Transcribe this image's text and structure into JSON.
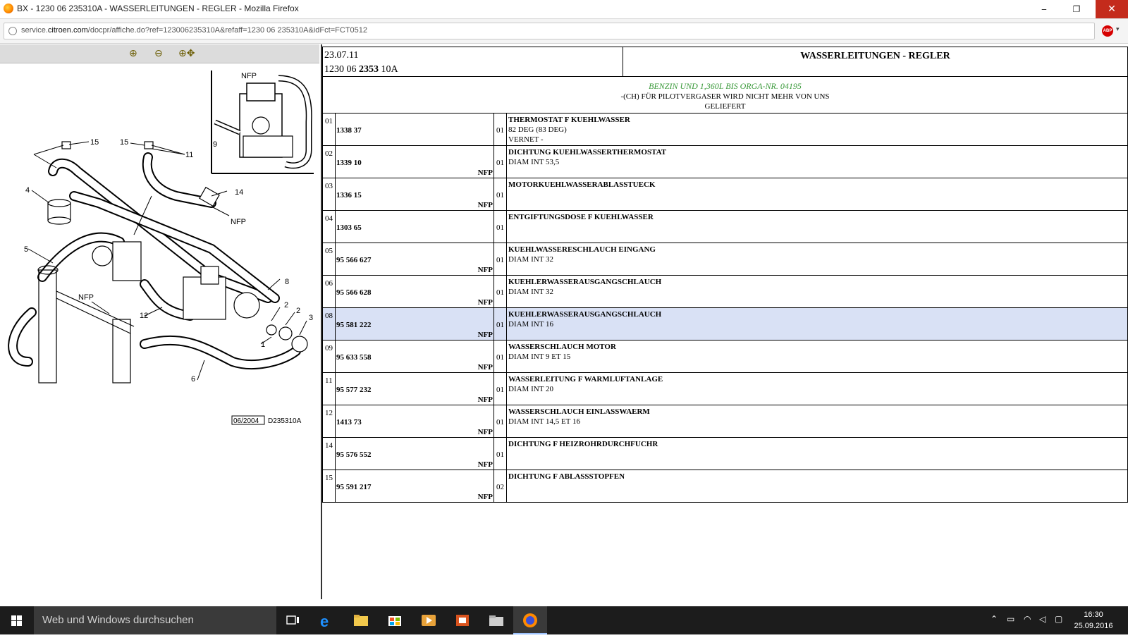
{
  "window": {
    "title": "BX - 1230 06 235310A - WASSERLEITUNGEN - REGLER - Mozilla Firefox",
    "minimize": "‒",
    "maximize": "❐",
    "close": "✕"
  },
  "address": {
    "url_pre": "service.",
    "url_domain": "citroen.com",
    "url_post": "/docpr/affiche.do?ref=123006235310A&refaff=1230 06 235310A&idFct=FCT0512",
    "abp": "ABP"
  },
  "toolbar": {
    "zoom_in": "⊕",
    "zoom_out": "⊖",
    "zoom_pan": "⊕✥"
  },
  "diagram": {
    "labels": [
      "NFP",
      "9",
      "15",
      "15",
      "11",
      "4",
      "14",
      "NFP",
      "5",
      "8",
      "NFP",
      "2",
      "2",
      "3",
      "12",
      "1",
      "6"
    ],
    "stamp_date": "06/2004",
    "stamp_code": "D235310A"
  },
  "header": {
    "date": "23.07.11",
    "part_pre": "1230 06 ",
    "part_bold": "2353",
    "part_post": " 10A",
    "title": "WASSERLEITUNGEN - REGLER"
  },
  "notes": {
    "green": "BENZIN UND 1,360L BIS ORGA-NR. 04195",
    "line1": "-(CH) FÜR PILOTVERGASER WIRD NICHT MEHR VON UNS",
    "line2": "GELIEFERT"
  },
  "rows": [
    {
      "idx": "01",
      "ref": "1338 37",
      "nfp": "",
      "qty": "01",
      "d1": "THERMOSTAT F KUEHLWASSER",
      "d2": "82 DEG (83 DEG)",
      "d3": "VERNET -"
    },
    {
      "idx": "02",
      "ref": "1339 10",
      "nfp": "NFP",
      "qty": "01",
      "d1": "DICHTUNG KUEHLWASSERTHERMOSTAT",
      "d2": "DIAM INT 53,5",
      "d3": ""
    },
    {
      "idx": "03",
      "ref": "1336 15",
      "nfp": "NFP",
      "qty": "01",
      "d1": "MOTORKUEHLWASSERABLASSTUECK",
      "d2": "",
      "d3": ""
    },
    {
      "idx": "04",
      "ref": "1303 65",
      "nfp": "",
      "qty": "01",
      "d1": "ENTGIFTUNGSDOSE F KUEHLWASSER",
      "d2": "",
      "d3": ""
    },
    {
      "idx": "05",
      "ref": "95 566 627",
      "nfp": "NFP",
      "qty": "01",
      "d1": "KUEHLWASSERESCHLAUCH EINGANG",
      "d2": "DIAM INT 32",
      "d3": ""
    },
    {
      "idx": "06",
      "ref": "95 566 628",
      "nfp": "NFP",
      "qty": "01",
      "d1": "KUEHLERWASSERAUSGANGSCHLAUCH",
      "d2": "DIAM INT 32",
      "d3": ""
    },
    {
      "idx": "08",
      "ref": "95 581 222",
      "nfp": "NFP",
      "qty": "01",
      "d1": "KUEHLERWASSERAUSGANGSCHLAUCH",
      "d2": "DIAM INT 16",
      "d3": "",
      "selected": true
    },
    {
      "idx": "09",
      "ref": "95 633 558",
      "nfp": "NFP",
      "qty": "01",
      "d1": "WASSERSCHLAUCH MOTOR",
      "d2": "DIAM INT 9 ET 15",
      "d3": ""
    },
    {
      "idx": "11",
      "ref": "95 577 232",
      "nfp": "NFP",
      "qty": "01",
      "d1": "WASSERLEITUNG F WARMLUFTANLAGE",
      "d2": "DIAM INT 20",
      "d3": ""
    },
    {
      "idx": "12",
      "ref": "1413 73",
      "nfp": "NFP",
      "qty": "01",
      "d1": "WASSERSCHLAUCH EINLASSWAERM",
      "d2": "DIAM INT 14,5 ET 16",
      "d3": ""
    },
    {
      "idx": "14",
      "ref": "95 576 552",
      "nfp": "NFP",
      "qty": "01",
      "d1": "DICHTUNG F HEIZROHRDURCHFUCHR",
      "d2": "",
      "d3": ""
    },
    {
      "idx": "15",
      "ref": "95 591 217",
      "nfp": "NFP",
      "qty": "02",
      "d1": "DICHTUNG F ABLASSSTOPFEN",
      "d2": "",
      "d3": ""
    }
  ],
  "taskbar": {
    "search_placeholder": "Web und Windows durchsuchen",
    "time": "16:30",
    "date": "25.09.2016",
    "icons": [
      "windows-start-icon",
      "task-view-icon",
      "edge-icon",
      "file-explorer-icon",
      "store-icon",
      "media-player-icon",
      "office-icon",
      "folder-icon",
      "firefox-icon"
    ]
  },
  "colors": {
    "selected_row": "#d9e1f5",
    "notes_green": "#3b9a3b",
    "close_red": "#c42b1c"
  }
}
